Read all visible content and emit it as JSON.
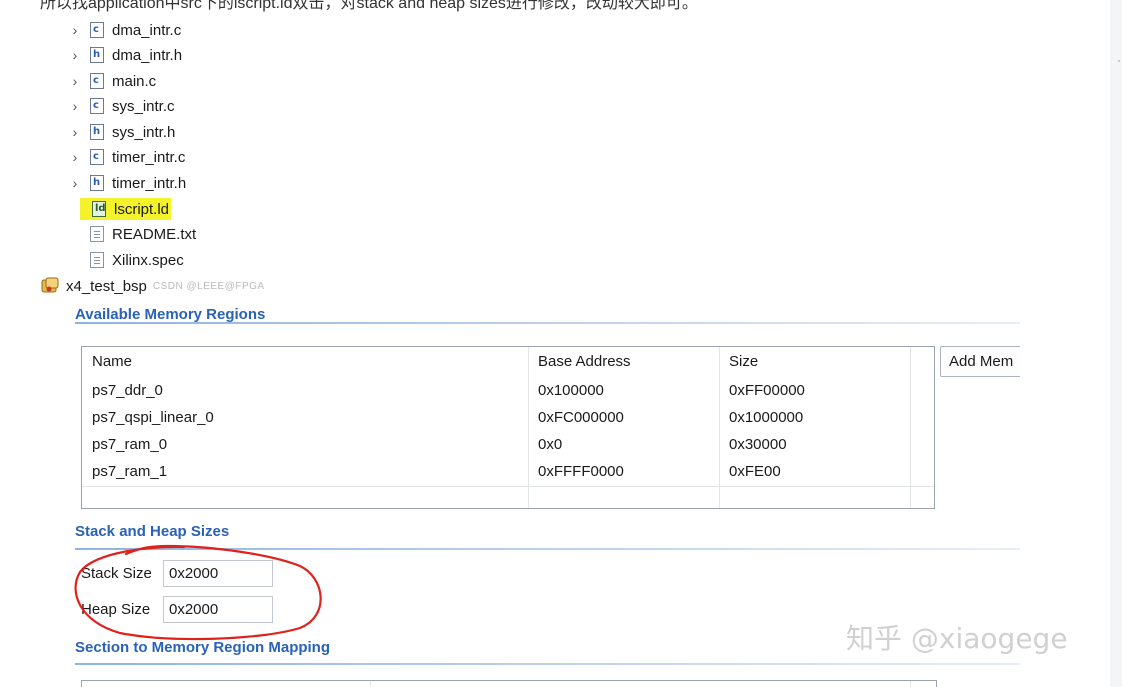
{
  "article": {
    "cut_text": "所以找application中src下的lscript.ld双击，对stack and heap sizes进行修改，改动较大即可。",
    "watermark_small": "CSDN @LEEE@FPGA",
    "watermark_big": "知乎 @xiaogege"
  },
  "tree": {
    "files": [
      {
        "name": "dma_intr.c",
        "ext": "c"
      },
      {
        "name": "dma_intr.h",
        "ext": "h"
      },
      {
        "name": "main.c",
        "ext": "c"
      },
      {
        "name": "sys_intr.c",
        "ext": "c"
      },
      {
        "name": "sys_intr.h",
        "ext": "h"
      },
      {
        "name": "timer_intr.c",
        "ext": "c"
      },
      {
        "name": "timer_intr.h",
        "ext": "h"
      }
    ],
    "plain_files": [
      "lscript.ld",
      "README.txt",
      "Xilinx.spec"
    ],
    "project": "x4_test_bsp"
  },
  "memory_regions": {
    "title": "Available Memory Regions",
    "headers": [
      "Name",
      "Base Address",
      "Size"
    ],
    "rows": [
      [
        "ps7_ddr_0",
        "0x100000",
        "0xFF00000"
      ],
      [
        "ps7_qspi_linear_0",
        "0xFC000000",
        "0x1000000"
      ],
      [
        "ps7_ram_0",
        "0x0",
        "0x30000"
      ],
      [
        "ps7_ram_1",
        "0xFFFF0000",
        "0xFE00"
      ]
    ],
    "add_button": "Add Mem"
  },
  "stack_heap": {
    "title": "Stack and Heap Sizes",
    "stack_label": "Stack Size",
    "stack_value": "0x2000",
    "heap_label": "Heap Size",
    "heap_value": "0x2000"
  },
  "section_mapping": {
    "title": "Section to Memory Region Mapping"
  },
  "colors": {
    "highlight": "#f4f22a",
    "annotation": "#e0201b",
    "section_title": "#2962b6"
  }
}
